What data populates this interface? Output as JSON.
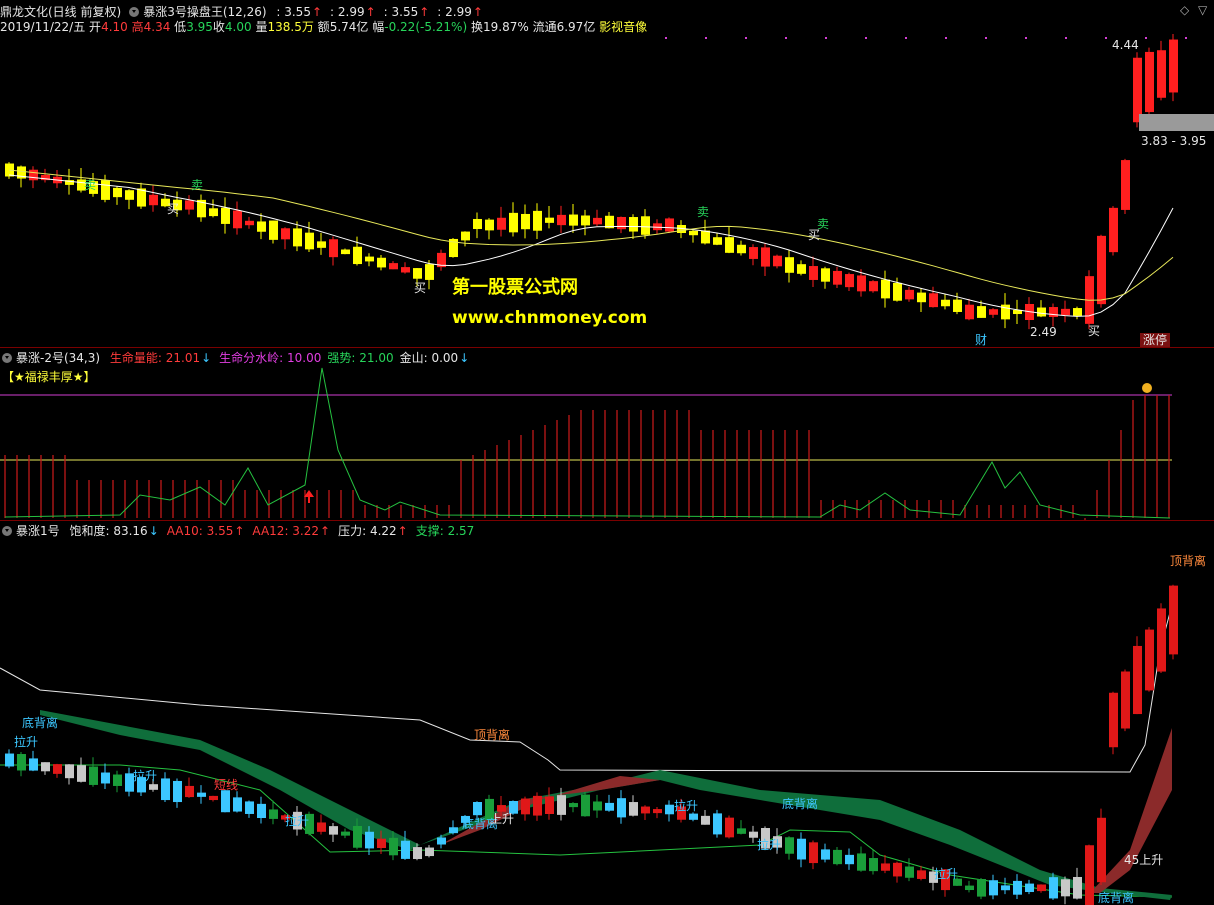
{
  "header": {
    "stock_name": "鼎龙文化(日线 前复权)",
    "indicator_name": "暴涨3号操盘王(12,26)",
    "values": [
      {
        "text": ": 3.55",
        "color": "white",
        "arrow": "↑",
        "arrow_color": "red"
      },
      {
        "text": ": 2.99",
        "color": "white",
        "arrow": "↑",
        "arrow_color": "red"
      },
      {
        "text": ": 3.55",
        "color": "white",
        "arrow": "↑",
        "arrow_color": "red"
      },
      {
        "text": ": 2.99",
        "color": "white",
        "arrow": "↑",
        "arrow_color": "red"
      }
    ],
    "corner_icons": [
      "◇",
      "▽"
    ]
  },
  "quote": {
    "date": "2019/11/22/五",
    "open_label": "开",
    "open": "4.10",
    "high_label": "高",
    "high": "4.34",
    "low_label": "低",
    "low": "3.95",
    "close_label": "收",
    "close": "4.00",
    "volume_label": "量",
    "volume": "138.5万",
    "amount_label": "额",
    "amount": "5.74亿",
    "change_label": "幅",
    "change": "-0.22(-5.21%)",
    "turnover_label": "换",
    "turnover": "19.87%",
    "float_label": "流通",
    "float": "6.97亿",
    "sector": "影视音像"
  },
  "main_chart": {
    "price_high_label": "4.44",
    "price_low_label": "2.49",
    "price_range_box": "3.83 - 3.95",
    "watermark_title": "第一股票公式网",
    "watermark_url": "www.chnmoney.com",
    "signals": [
      {
        "text": "卖",
        "color": "green"
      },
      {
        "text": "卖",
        "color": "green"
      },
      {
        "text": "买",
        "color": "white"
      },
      {
        "text": "买",
        "color": "white"
      },
      {
        "text": "卖",
        "color": "green"
      },
      {
        "text": "买",
        "color": "white"
      },
      {
        "text": "卖",
        "color": "green"
      },
      {
        "text": "买",
        "color": "white"
      }
    ],
    "badge_cai": "财",
    "badge_zhangting": "涨停"
  },
  "panel2": {
    "name": "暴涨-2号(34,3)",
    "items": [
      {
        "label": "生命量能: 21.01",
        "color": "red",
        "arrow": "↓",
        "arrow_color": "cyan"
      },
      {
        "label": "生命分水岭: 10.00",
        "color": "magenta",
        "arrow": "",
        "arrow_color": "cyan"
      },
      {
        "label": "强势: 21.00",
        "color": "green",
        "arrow": "",
        "arrow_color": "cyan"
      },
      {
        "label": "金山: 0.00",
        "color": "white",
        "arrow": "↓",
        "arrow_color": "cyan"
      }
    ],
    "banner": "【★福禄丰厚★】"
  },
  "panel3": {
    "name": "暴涨1号",
    "items": [
      {
        "label": "饱和度: 83.16",
        "color": "white",
        "arrow": "↓",
        "arrow_color": "cyan"
      },
      {
        "label": "AA10: 3.55",
        "color": "red",
        "arrow": "↑",
        "arrow_color": "red"
      },
      {
        "label": "AA12: 3.22",
        "color": "red",
        "arrow": "↑",
        "arrow_color": "red"
      },
      {
        "label": "压力: 4.22",
        "color": "white",
        "arrow": "↑",
        "arrow_color": "red"
      },
      {
        "label": "支撑: 2.57",
        "color": "green",
        "arrow": "",
        "arrow_color": "red"
      }
    ],
    "annotations": [
      {
        "text": "顶背离",
        "color": "orange"
      },
      {
        "text": "顶背离",
        "color": "orange"
      },
      {
        "text": "底背离",
        "color": "cyan"
      },
      {
        "text": "底背离",
        "color": "cyan"
      },
      {
        "text": "底背离",
        "color": "cyan"
      },
      {
        "text": "底背离",
        "color": "cyan"
      },
      {
        "text": "拉升",
        "color": "cyan"
      },
      {
        "text": "拉升",
        "color": "cyan"
      },
      {
        "text": "拉升",
        "color": "cyan"
      },
      {
        "text": "拉升",
        "color": "cyan"
      },
      {
        "text": "拉升",
        "color": "cyan"
      },
      {
        "text": "拉升",
        "color": "cyan"
      },
      {
        "text": "短线",
        "color": "red"
      },
      {
        "text": "45上升",
        "color": "white"
      },
      {
        "text": "上升",
        "color": "white"
      }
    ]
  }
}
